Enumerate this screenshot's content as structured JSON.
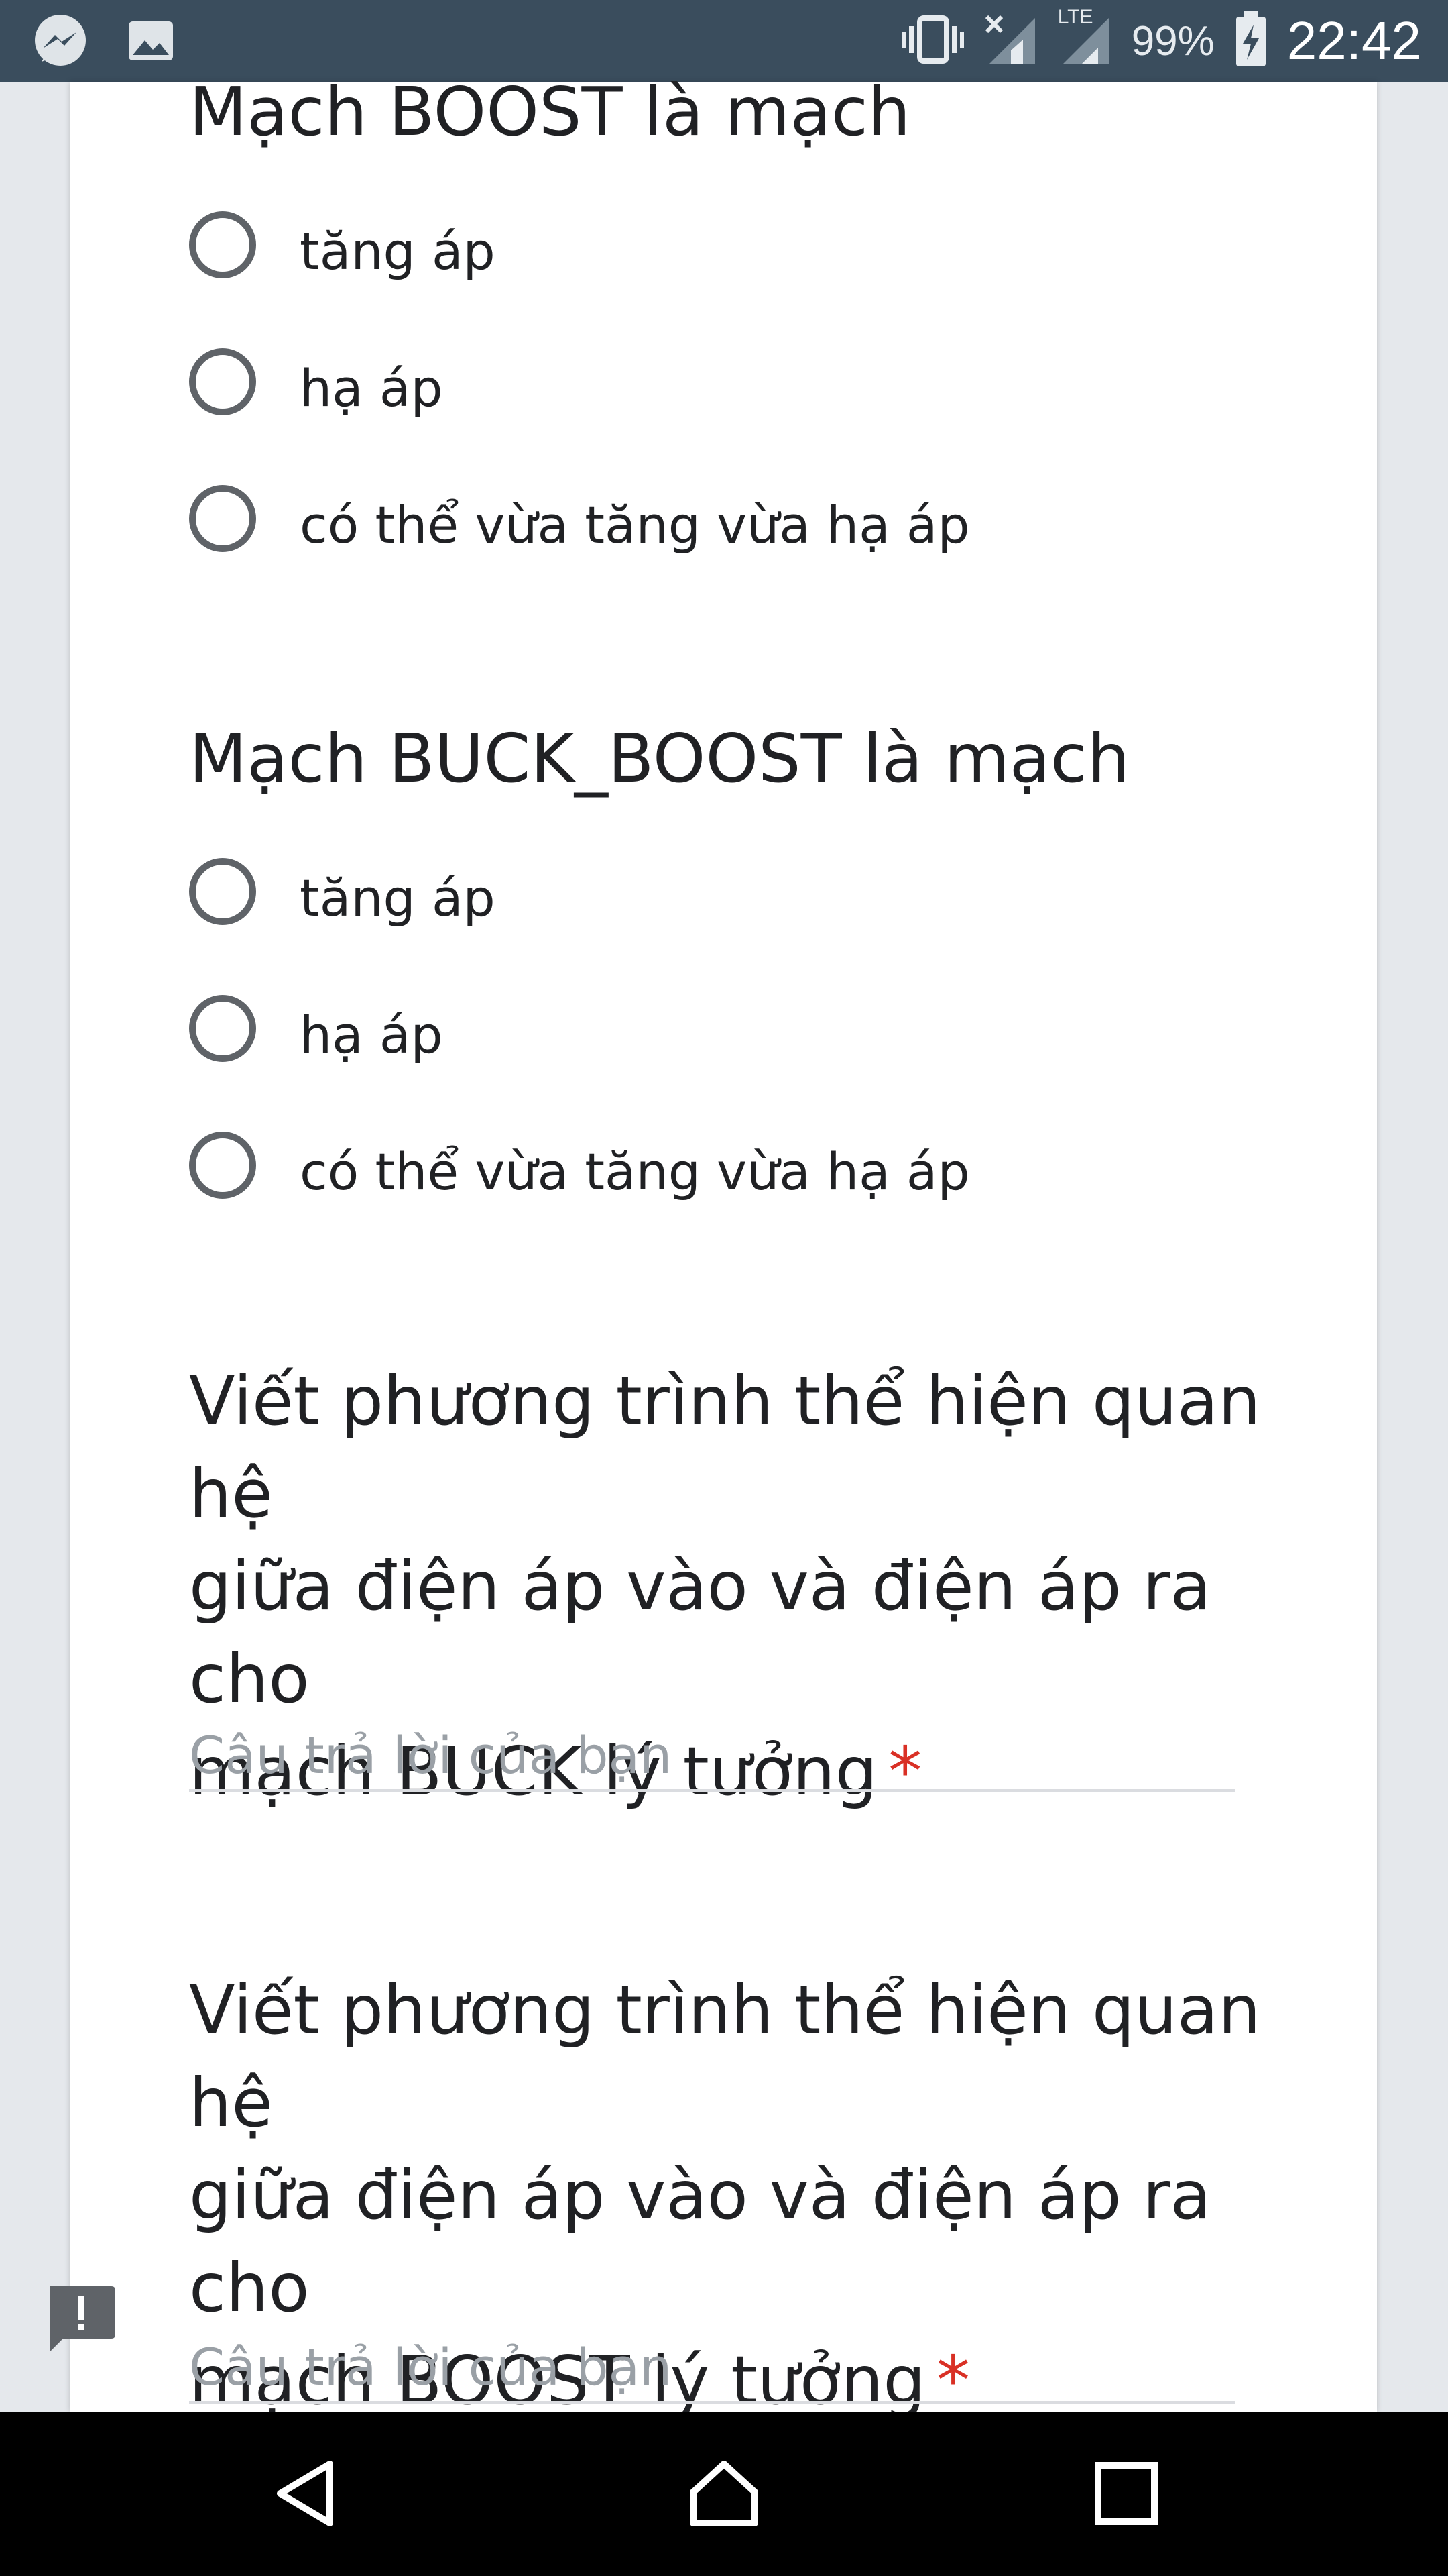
{
  "status_bar": {
    "battery_percent": "99%",
    "time": "22:42",
    "left_icons": [
      "messenger-icon",
      "image-icon"
    ],
    "right_icons": [
      "vibrate-icon",
      "signal-no-sim-icon",
      "signal-lte-icon",
      "battery-charging-icon"
    ],
    "network_label": "LTE"
  },
  "form": {
    "questions": [
      {
        "title": "Mạch BOOST là mạch",
        "type": "radio",
        "options": [
          "tăng áp",
          "hạ áp",
          "có thể vừa tăng vừa hạ áp"
        ]
      },
      {
        "title": "Mạch BUCK_BOOST là mạch",
        "type": "radio",
        "options": [
          "tăng áp",
          "hạ áp",
          "có thể vừa tăng vừa hạ áp"
        ]
      },
      {
        "title_lines": [
          "Viết phương trình thể hiện quan hệ",
          "giữa điện áp vào và điện áp ra cho",
          "mạch BUCK lý tưởng"
        ],
        "required_mark": "*",
        "type": "short_answer",
        "placeholder": "Câu trả lời của bạn"
      },
      {
        "title_lines": [
          "Viết phương trình thể hiện quan hệ",
          "giữa điện áp vào và điện áp ra cho",
          "mạch BOOST lý tưởng"
        ],
        "required_mark": "*",
        "type": "short_answer",
        "placeholder": "Câu trả lời của bạn"
      }
    ]
  },
  "feedback": {
    "icon": "feedback-icon"
  },
  "nav_bar": {
    "buttons": [
      "back-icon",
      "home-icon",
      "recents-icon"
    ]
  },
  "colors": {
    "status_bar_bg": "#3a4d5d",
    "required_red": "#d93025",
    "page_bg": "#e5e8ec",
    "radio_border": "#5f6368",
    "placeholder_gray": "#9aa0a6"
  }
}
